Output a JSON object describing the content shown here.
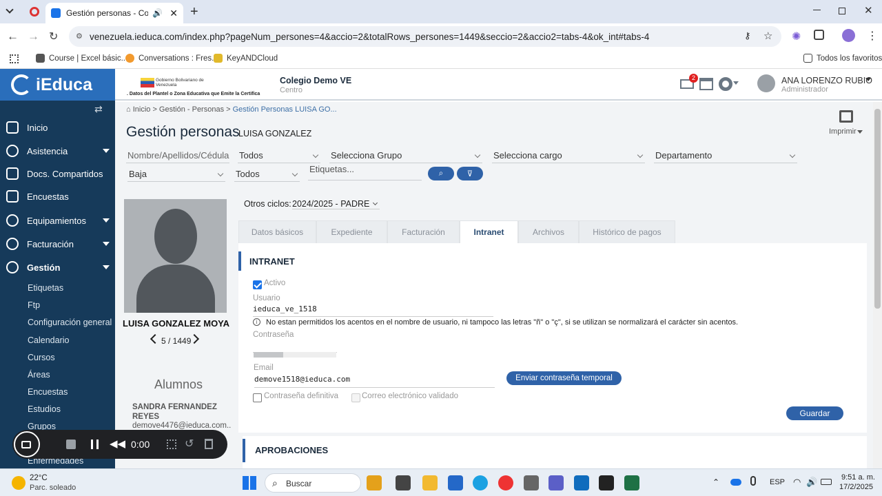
{
  "browser": {
    "tab_title": "Gestión personas - Colegio",
    "url": "venezuela.ieduca.com/index.php?pageNum_persones=4&accio=2&totalRows_persones=1449&seccio=2&accio2=tabs-4&ok_int#tabs-4",
    "bookmarks": [
      "Course | Excel básic...",
      "Conversations : Fres...",
      "KeyANDCloud"
    ],
    "bookmarks_right": "Todos los favoritos"
  },
  "header": {
    "logo": "iEduca",
    "gov_line": ". Datos del Plantel o Zona Educativa que Emite la Certifica",
    "gov_small": "Gobierno Bolivariano de Venezuela",
    "school": "Colegio Demo VE",
    "school_sub": "Centro",
    "mail_badge": "2",
    "user_name": "ANA LORENZO RUBIO",
    "user_role": "Administrador"
  },
  "sidebar": {
    "items": [
      {
        "label": "Inicio"
      },
      {
        "label": "Asistencia"
      },
      {
        "label": "Docs. Compartidos"
      },
      {
        "label": "Encuestas"
      },
      {
        "label": "Equipamientos"
      },
      {
        "label": "Facturación"
      },
      {
        "label": "Gestión"
      }
    ],
    "subitems": [
      "Etiquetas",
      "Ftp",
      "Configuración general",
      "Calendario",
      "Cursos",
      "Áreas",
      "Encuestas",
      "Estudios",
      "Grupos",
      "Enfermedades"
    ]
  },
  "main": {
    "breadcrumb": "Inicio > Gestión - Personas > ",
    "breadcrumb_current": "Gestión Personas LUISA GO...",
    "page_title": "Gestión personas",
    "page_subtitle": "LUISA GONZALEZ",
    "print_label": "Imprimir",
    "filters": {
      "name_placeholder": "Nombre/Apellidos/Cédula",
      "todos1": "Todos",
      "grupo": "Selecciona Grupo",
      "cargo": "Selecciona cargo",
      "departamento": "Departamento",
      "baja": "Baja",
      "todos2": "Todos",
      "etiquetas": "Etiquetas..."
    },
    "person": {
      "name": "LUISA GONZALEZ MOYA",
      "pager": "5 / 1449",
      "alumnos_title": "Alumnos",
      "student_name": "SANDRA FERNANDEZ REYES",
      "student_email": "demove4476@ieduca.com..."
    },
    "otros_ciclos_label": "Otros ciclos:",
    "otros_ciclos_value": "2024/2025 - PADRE",
    "tabs": [
      "Datos básicos",
      "Expediente",
      "Facturación",
      "Intranet",
      "Archivos",
      "Histórico de pagos"
    ],
    "intranet": {
      "section_title": "INTRANET",
      "activo_label": "Activo",
      "usuario_label": "Usuario",
      "usuario_value": "ieduca_ve_1518",
      "notice": "No estan permitidos los acentos en el nombre de usuario, ni tampoco las letras \"ñ\" o \"ç\", si se utilizan se normalizará el carácter sin acentos.",
      "contrasena_label": "Contraseña",
      "email_label": "Email",
      "email_value": "demove1518@ieduca.com",
      "send_temp_btn": "Enviar contraseña temporal",
      "definitiva_label": "Contraseña definitiva",
      "validado_label": "Correo electrónico validado",
      "guardar_btn": "Guardar"
    },
    "aprobaciones_title": "APROBACIONES"
  },
  "recorder": {
    "time": "0:00"
  },
  "taskbar": {
    "weather_temp": "22°C",
    "weather_desc": "Parc. soleado",
    "search": "Buscar",
    "lang": "ESP",
    "time": "9:51 a. m.",
    "date": "17/2/2025"
  }
}
